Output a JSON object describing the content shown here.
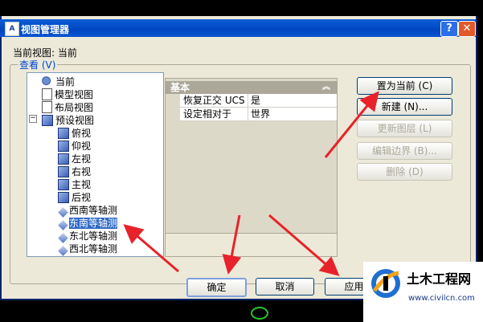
{
  "window": {
    "title": "视图管理器",
    "app_icon": "autocad-icon",
    "help_label": "?",
    "close_label": "✕"
  },
  "current_view": {
    "label": "当前视图: 当前"
  },
  "group": {
    "label": "查看 (V)"
  },
  "tree": {
    "items": [
      {
        "label": "当前",
        "icon": "magnifier-icon"
      },
      {
        "label": "模型视图",
        "icon": "model-view-icon"
      },
      {
        "label": "布局视图",
        "icon": "layout-view-icon"
      },
      {
        "label": "预设视图",
        "icon": "preset-view-icon"
      },
      {
        "label": "俯视",
        "icon": "cube-icon"
      },
      {
        "label": "仰视",
        "icon": "cube-icon"
      },
      {
        "label": "左视",
        "icon": "cube-icon"
      },
      {
        "label": "右视",
        "icon": "cube-icon"
      },
      {
        "label": "主视",
        "icon": "cube-icon"
      },
      {
        "label": "后视",
        "icon": "cube-icon"
      },
      {
        "label": "西南等轴测",
        "icon": "iso-icon"
      },
      {
        "label": "东南等轴测",
        "icon": "iso-icon",
        "selected": true
      },
      {
        "label": "东北等轴测",
        "icon": "iso-icon"
      },
      {
        "label": "西北等轴测",
        "icon": "iso-icon"
      }
    ]
  },
  "properties": {
    "header": "基本",
    "rows": [
      {
        "key": "恢复正交 UCS",
        "value": "是"
      },
      {
        "key": "设定相对于",
        "value": "世界"
      }
    ]
  },
  "side_buttons": [
    {
      "label": "置为当前 (C)",
      "enabled": true
    },
    {
      "label": "新建 (N)...",
      "enabled": true
    },
    {
      "label": "更新图层 (L)",
      "enabled": false
    },
    {
      "label": "编辑边界 (B)...",
      "enabled": false
    },
    {
      "label": "删除 (D)",
      "enabled": false
    }
  ],
  "bottom_buttons": {
    "ok": "确定",
    "cancel": "取消",
    "apply": "应用"
  },
  "watermark": {
    "brand": "土木工程网",
    "url": "www.civilcn.com"
  },
  "colors": {
    "title_bar": "#0A5FD8",
    "dialog_bg": "#ECE9D8",
    "selection": "#316AC5",
    "arrow": "#E8222A"
  }
}
